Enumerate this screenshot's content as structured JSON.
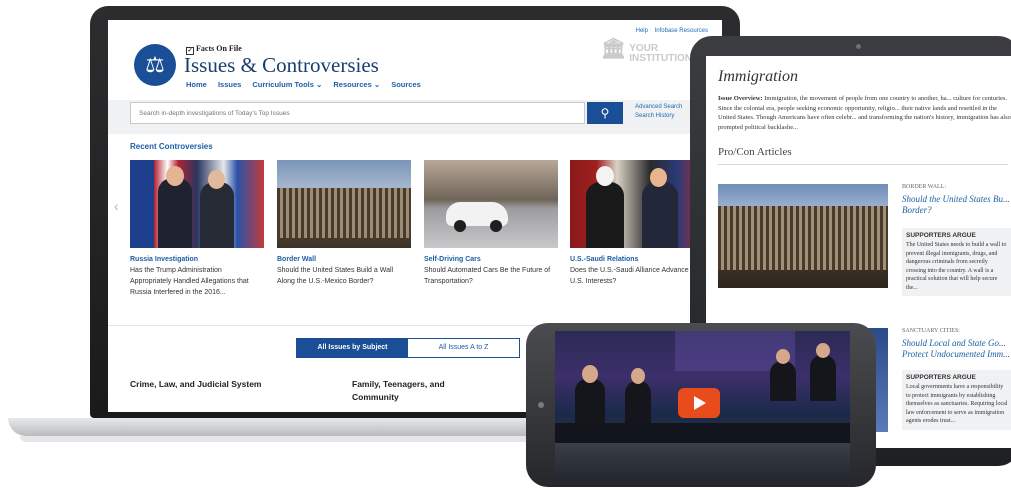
{
  "laptop": {
    "top_links": [
      "Help",
      "Infobase Resources"
    ],
    "brand_small": "Facts On File",
    "brand_title": "Issues & Controversies",
    "nav": [
      "Home",
      "Issues",
      "Curriculum Tools ⌄",
      "Resources ⌄",
      "Sources"
    ],
    "institution": [
      "YOUR",
      "INSTITUTION"
    ],
    "search": {
      "placeholder": "Search in-depth investigations of Today's Top Issues",
      "links": [
        "Advanced Search",
        "Search History"
      ]
    },
    "recent_label": "Recent Controversies",
    "cards": [
      {
        "title": "Russia Investigation",
        "desc": "Has the Trump Administration Appropriately Handled Allegations that Russia Interfered in the 2016..."
      },
      {
        "title": "Border Wall",
        "desc": "Should the United States Build a Wall Along the U.S.-Mexico Border?"
      },
      {
        "title": "Self-Driving Cars",
        "desc": "Should Automated Cars Be the Future of Transportation?"
      },
      {
        "title": "U.S.-Saudi Relations",
        "desc": "Does the U.S.-Saudi Alliance Advance U.S. Interests?"
      }
    ],
    "tabs": [
      "All Issues by Subject",
      "All Issues A to Z"
    ],
    "subjects": [
      "Crime, Law, and Judicial System",
      "Family, Teenagers, and Community"
    ]
  },
  "tablet": {
    "heading": "Immigration",
    "overview_label": "Issue Overview:",
    "overview_text": "Immigration, the movement of people from one country to another, ha... culture for centuries. Since the colonial era, people seeking economic opportunity, religio... their native lands and resettled in the United States. Though Americans have often celebr... and transforming the nation's history, immigration has also prompted political backlashe...",
    "subheading": "Pro/Con Articles",
    "articles": [
      {
        "category": "BORDER WALL:",
        "question": "Should the United States Bu... Border?",
        "box_heading": "SUPPORTERS ARGUE",
        "box_text": "The United States needs to build a wall to prevent illegal immigrants, drugs, and dangerous criminals from secretly crossing into the country. A wall is a practical solution that will help secure the..."
      },
      {
        "category": "SANCTUARY CITIES:",
        "question": "Should Local and State Go... Protect Undocumented Imm...",
        "box_heading": "SUPPORTERS ARGUE",
        "box_text": "Local governments have a responsibility to protect immigrants by establishing themselves as sanctuaries. Requiring local law enforcement to serve as immigration agents erodes trust..."
      }
    ]
  },
  "phone": {
    "play_icon": "play-icon",
    "accent": "#e84c1d"
  }
}
